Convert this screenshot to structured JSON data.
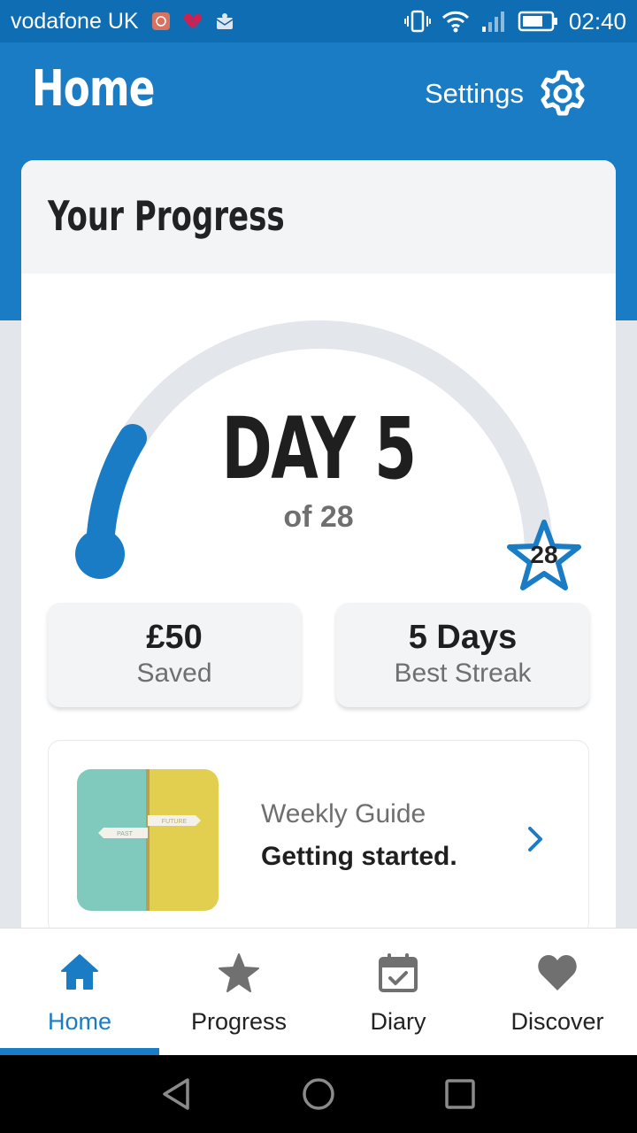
{
  "status_bar": {
    "carrier": "vodafone UK",
    "time": "02:40"
  },
  "header": {
    "title": "Home",
    "settings_label": "Settings"
  },
  "progress_card": {
    "title": "Your Progress",
    "day_label": "DAY 5",
    "of_label": "of 28",
    "current_day": 5,
    "total_days": 28,
    "goal_badge": "28"
  },
  "stats": [
    {
      "value": "£50",
      "label": "Saved"
    },
    {
      "value": "5 Days",
      "label": "Best Streak"
    }
  ],
  "guide": {
    "kicker": "Weekly Guide",
    "title": "Getting started.",
    "thumb_left_sign": "PAST",
    "thumb_right_sign": "FUTURE"
  },
  "bottom_nav": {
    "items": [
      {
        "label": "Home",
        "icon": "home-icon",
        "active": true
      },
      {
        "label": "Progress",
        "icon": "star-icon",
        "active": false
      },
      {
        "label": "Diary",
        "icon": "calendar-check-icon",
        "active": false
      },
      {
        "label": "Discover",
        "icon": "heart-icon",
        "active": false
      }
    ]
  },
  "colors": {
    "brand": "#1a7cc4",
    "status_bar": "#0f6eb3",
    "track": "#e3e6ea",
    "text_dark": "#1f1f1f",
    "text_muted": "#6f6f6f"
  }
}
